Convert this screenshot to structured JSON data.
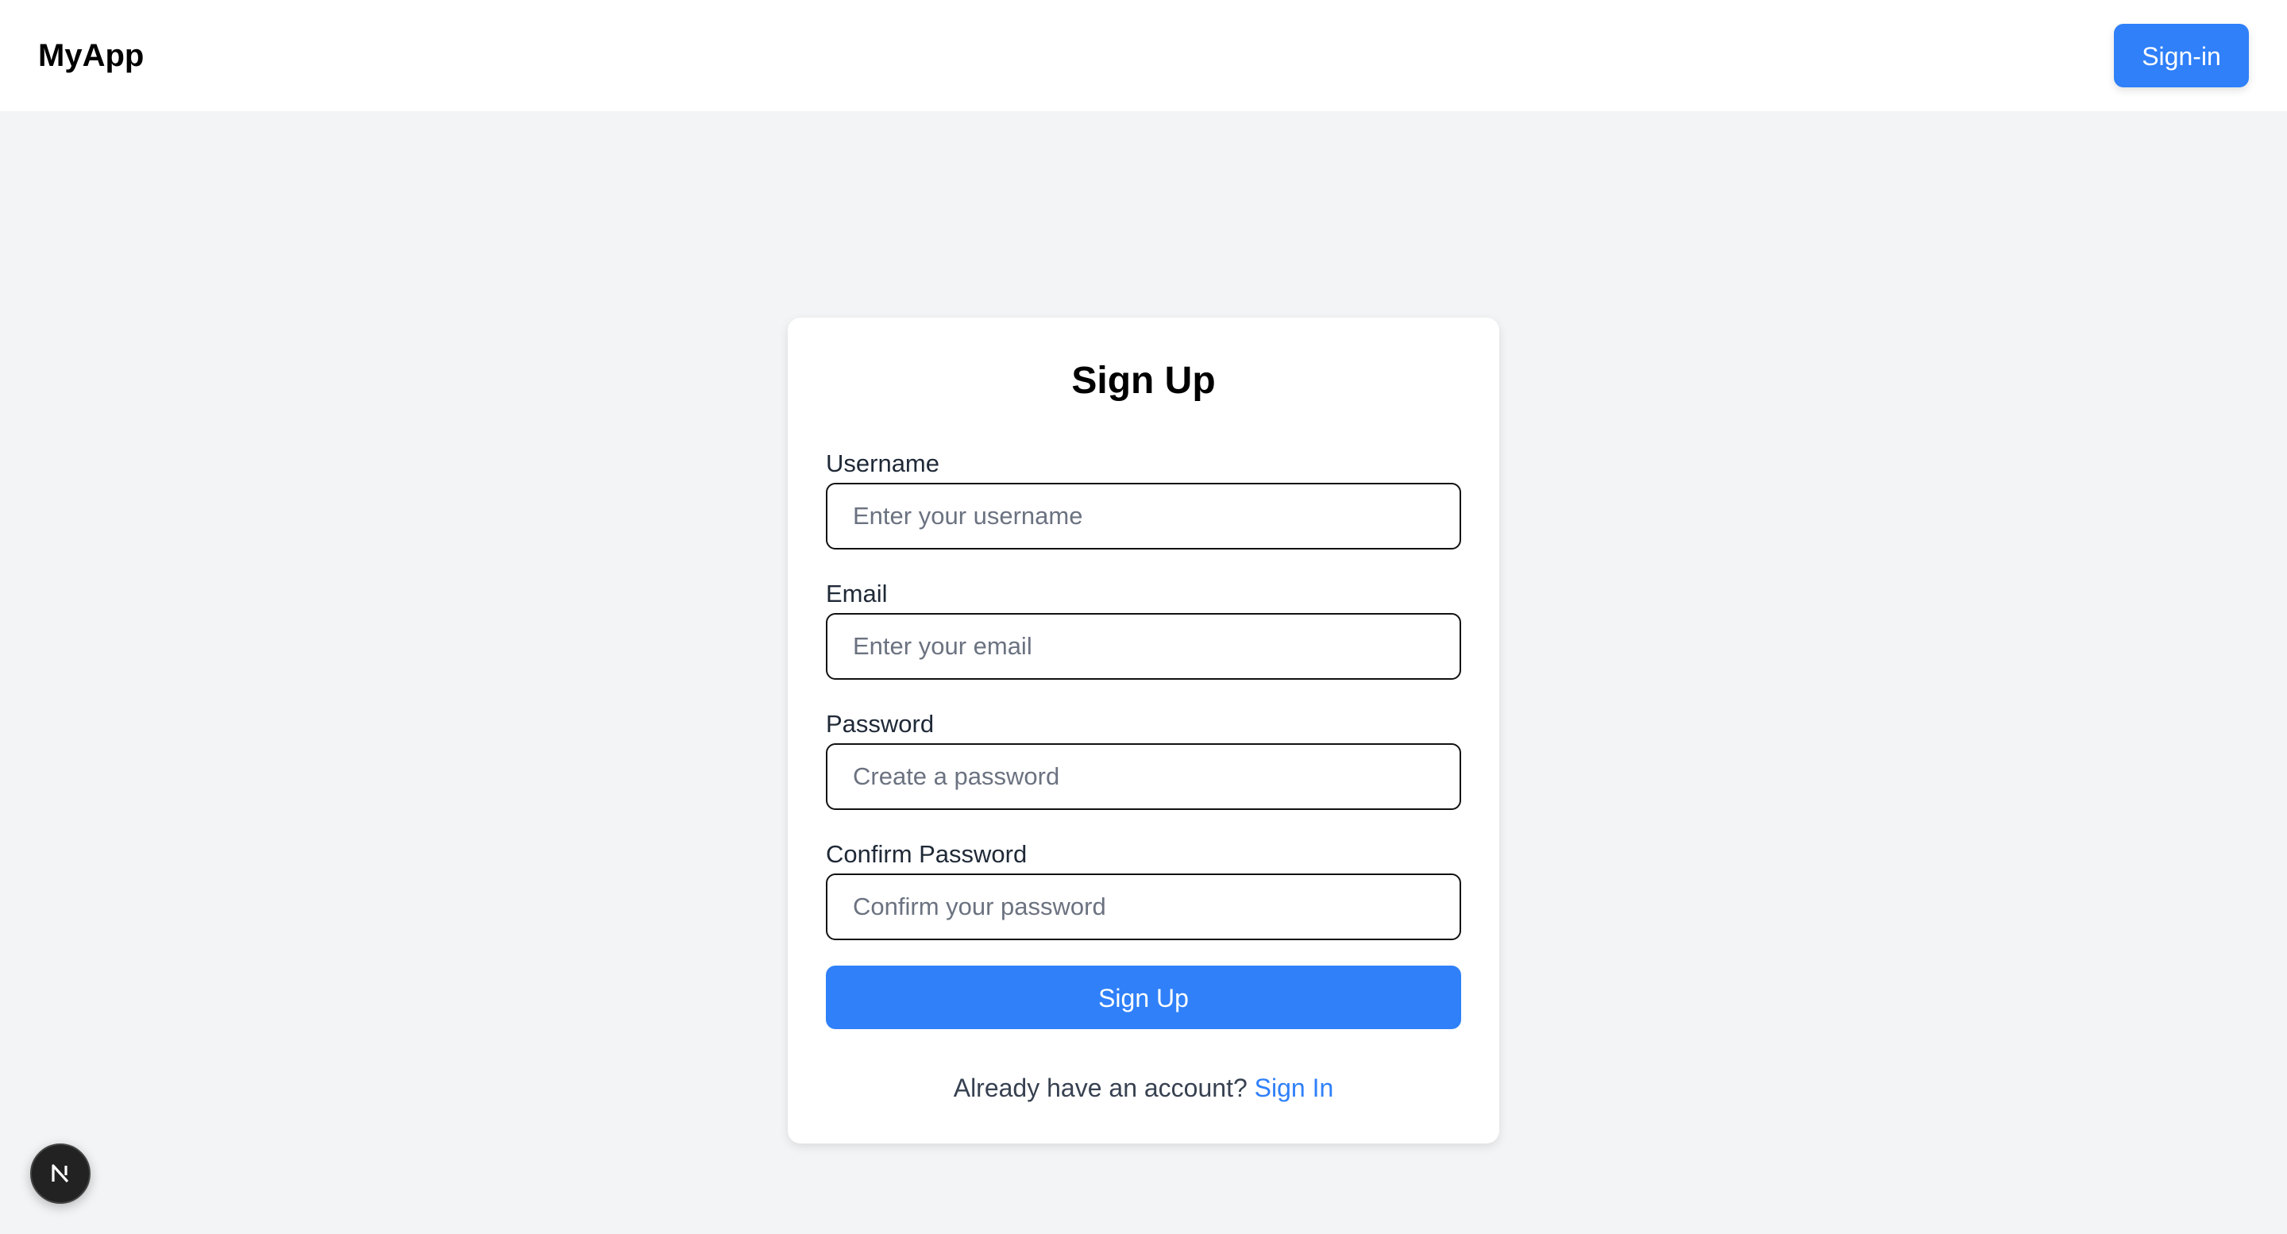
{
  "header": {
    "brand": "MyApp",
    "signin_label": "Sign-in"
  },
  "form": {
    "title": "Sign Up",
    "fields": [
      {
        "label": "Username",
        "placeholder": "Enter your username",
        "value": ""
      },
      {
        "label": "Email",
        "placeholder": "Enter your email",
        "value": ""
      },
      {
        "label": "Password",
        "placeholder": "Create a password",
        "value": ""
      },
      {
        "label": "Confirm Password",
        "placeholder": "Confirm your password",
        "value": ""
      }
    ],
    "submit_label": "Sign Up",
    "footer_text": "Already have an account?",
    "footer_link": "Sign In"
  },
  "dev_badge": {
    "icon": "nextjs-logo-icon",
    "letter": "N"
  },
  "colors": {
    "accent": "#2f80f9",
    "page_background": "#f3f4f6",
    "card_background": "#ffffff"
  }
}
